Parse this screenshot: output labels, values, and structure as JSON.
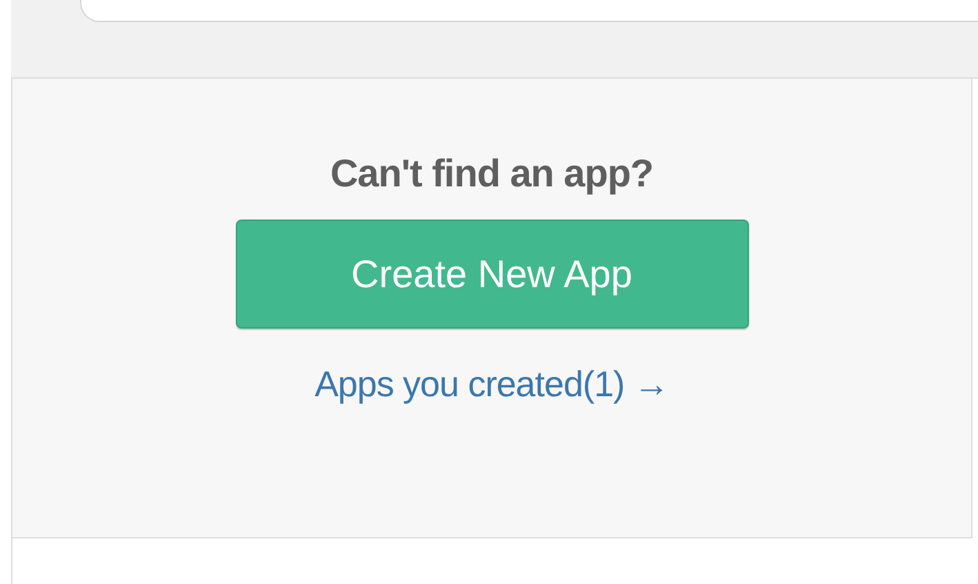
{
  "prompt": {
    "heading": "Can't find an app?",
    "button": "Create New App",
    "link": "Apps you created(1) →"
  }
}
